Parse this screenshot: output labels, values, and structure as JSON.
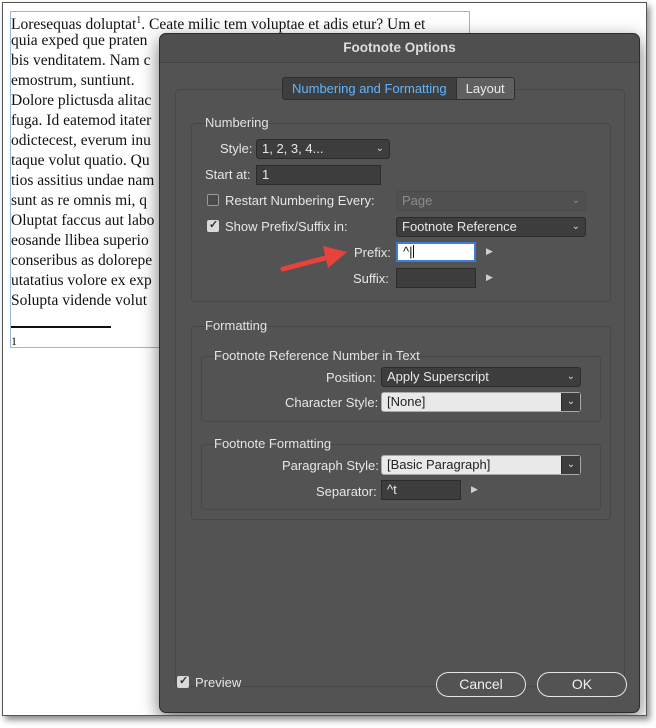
{
  "document": {
    "lines": [
      "Loresequas doluptat",
      "quia exped que praten",
      "bis venditatem. Nam c",
      "emostrum, suntiunt.",
      "Dolore plictusda alitac",
      "fuga. Id eatemod itater",
      "odictecest, everum inu",
      "taque volut quatio. Qu",
      "tios assitius undae nam",
      "sunt as re omnis mi, q",
      "Oluptat faccus aut labo",
      "eosande llibea superio",
      "conseribus as dolorepe",
      "utatatius volore ex exp",
      "Solupta vidende volut"
    ],
    "footnote_marker": "1",
    "first_line_rest": ". Ceate milic tem voluptae et adis etur? Um et",
    "footnote_number": "1"
  },
  "dialog": {
    "title": "Footnote Options",
    "tabs": [
      {
        "label": "Numbering and Formatting",
        "active": true
      },
      {
        "label": "Layout",
        "active": false
      }
    ],
    "numbering": {
      "section_label": "Numbering",
      "style_label": "Style:",
      "style_value": "1, 2, 3, 4...",
      "start_label": "Start at:",
      "start_value": "1",
      "restart_label": "Restart Numbering Every:",
      "restart_checked": false,
      "restart_value": "Page",
      "show_label": "Show Prefix/Suffix in:",
      "show_checked": true,
      "show_value": "Footnote Reference",
      "prefix_label": "Prefix:",
      "prefix_value": "^|",
      "suffix_label": "Suffix:",
      "suffix_value": ""
    },
    "formatting": {
      "section_label": "Formatting",
      "reference": {
        "label": "Footnote Reference Number in Text",
        "position_label": "Position:",
        "position_value": "Apply Superscript",
        "char_style_label": "Character Style:",
        "char_style_value": "[None]"
      },
      "footnote": {
        "label": "Footnote Formatting",
        "para_style_label": "Paragraph Style:",
        "para_style_value": "[Basic Paragraph]",
        "separator_label": "Separator:",
        "separator_value": "^t"
      }
    },
    "preview_label": "Preview",
    "preview_checked": true,
    "cancel_label": "Cancel",
    "ok_label": "OK"
  },
  "colors": {
    "dialog_bg": "#535353",
    "active_tab_text": "#5fb6ff",
    "annotation_arrow": "#e8433a"
  }
}
